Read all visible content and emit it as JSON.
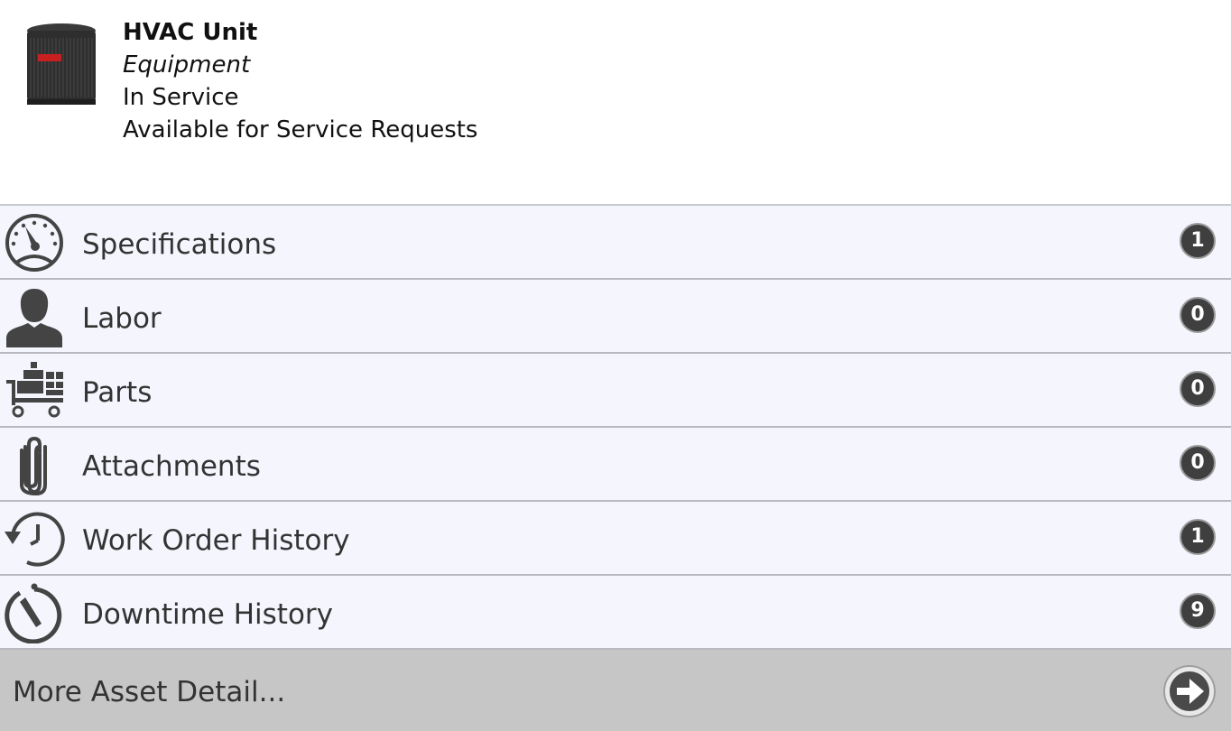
{
  "asset": {
    "name": "HVAC Unit",
    "type": "Equipment",
    "status": "In Service",
    "availability": "Available for Service Requests",
    "image_icon": "hvac-unit-photo"
  },
  "sections": [
    {
      "label": "Specifications",
      "count": "1",
      "icon": "speedometer-icon"
    },
    {
      "label": "Labor",
      "count": "0",
      "icon": "person-icon"
    },
    {
      "label": "Parts",
      "count": "0",
      "icon": "parts-cart-icon"
    },
    {
      "label": "Attachments",
      "count": "0",
      "icon": "paperclip-icon"
    },
    {
      "label": "Work Order History",
      "count": "1",
      "icon": "history-icon"
    },
    {
      "label": "Downtime History",
      "count": "9",
      "icon": "stopwatch-icon"
    }
  ],
  "more": {
    "label": "More Asset Detail...",
    "icon": "arrow-right-circle-icon"
  },
  "colors": {
    "row_bg": "#f4f5fd",
    "badge_bg": "#3f3f3f",
    "footer_bg": "#c6c6c6"
  }
}
